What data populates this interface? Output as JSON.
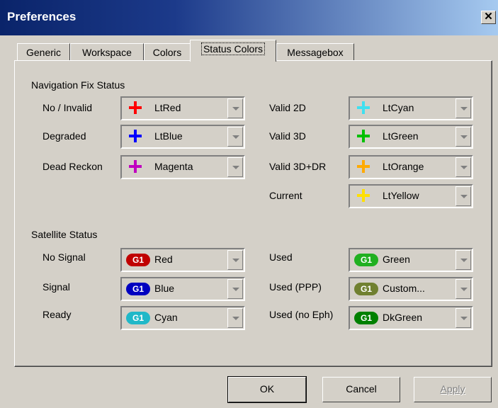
{
  "window": {
    "title": "Preferences",
    "close_glyph": "✕"
  },
  "tabs": [
    {
      "label": "Generic"
    },
    {
      "label": "Workspace"
    },
    {
      "label": "Colors"
    },
    {
      "label": "Status Colors",
      "active": true
    },
    {
      "label": "Messagebox"
    }
  ],
  "nav_fix": {
    "title": "Navigation Fix Status",
    "rows": [
      {
        "label": "No / Invalid",
        "value": "LtRed",
        "color": "#ff0000"
      },
      {
        "label": "Degraded",
        "value": "LtBlue",
        "color": "#0000ff"
      },
      {
        "label": "Dead Reckon",
        "value": "Magenta",
        "color": "#c000c0"
      },
      {
        "label": "Valid 2D",
        "value": "LtCyan",
        "color": "#40e0f0"
      },
      {
        "label": "Valid 3D",
        "value": "LtGreen",
        "color": "#00c000"
      },
      {
        "label": "Valid 3D+DR",
        "value": "LtOrange",
        "color": "#ffaa00"
      },
      {
        "label": "Current",
        "value": "LtYellow",
        "color": "#ffe000"
      }
    ]
  },
  "satellite": {
    "title": "Satellite Status",
    "badge_text": "G1",
    "rows": [
      {
        "label": "No Signal",
        "value": "Red",
        "color": "#c00000"
      },
      {
        "label": "Signal",
        "value": "Blue",
        "color": "#0000c0"
      },
      {
        "label": "Ready",
        "value": "Cyan",
        "color": "#20b8c8"
      },
      {
        "label": "Used",
        "value": "Green",
        "color": "#20b020"
      },
      {
        "label": "Used (PPP)",
        "value": "Custom...",
        "color": "#708030"
      },
      {
        "label": "Used (no Eph)",
        "value": "DkGreen",
        "color": "#008000"
      }
    ]
  },
  "buttons": {
    "ok": "OK",
    "cancel": "Cancel",
    "apply": "Apply"
  }
}
